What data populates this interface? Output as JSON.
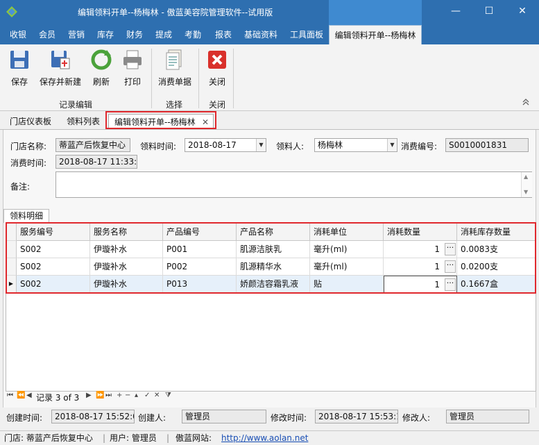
{
  "window": {
    "title": "编辑领料开单--杨梅林 - 傲蓝美容院管理软件--试用版",
    "min_glyph": "—",
    "max_glyph": "☐",
    "close_glyph": "✕"
  },
  "ribbon_tabs": [
    "收银",
    "会员",
    "营销",
    "库存",
    "财务",
    "提成",
    "考勤",
    "报表",
    "基础资料",
    "工具面板",
    "编辑领料开单--杨梅林"
  ],
  "ribbon": {
    "save": "保存",
    "save_new": "保存并新建",
    "refresh": "刷新",
    "print": "打印",
    "consume_doc": "消费单据",
    "close": "关闭",
    "group_record": "记录编辑",
    "group_select": "选择",
    "group_close": "关闭"
  },
  "doc_tabs": {
    "dashboard": "门店仪表板",
    "list": "领料列表",
    "edit": "编辑领料开单--杨梅林",
    "close_glyph": "✕"
  },
  "form": {
    "store_label": "门店名称:",
    "store_value": "蒂蓝产后恢复中心",
    "pick_time_label": "领料时间:",
    "pick_time_value": "2018-08-17",
    "picker_label": "领料人:",
    "picker_value": "杨梅林",
    "consume_no_label": "消费编号:",
    "consume_no_value": "S0010001831",
    "consume_time_label": "消费时间:",
    "consume_time_value": "2018-08-17 11:33:3",
    "remark_label": "备注:",
    "remark_value": ""
  },
  "detail_tab": "领料明细",
  "grid": {
    "columns": [
      "服务编号",
      "服务名称",
      "产品编号",
      "产品名称",
      "消耗单位",
      "消耗数量",
      "消耗库存数量"
    ],
    "rows": [
      [
        "S002",
        "伊璇补水",
        "P001",
        "肌源洁肤乳",
        "毫升(ml)",
        "1",
        "0.0083支"
      ],
      [
        "S002",
        "伊璇补水",
        "P002",
        "肌源精华水",
        "毫升(ml)",
        "1",
        "0.0200支"
      ],
      [
        "S002",
        "伊璇补水",
        "P013",
        "娇颜洁容霜乳液",
        "贴",
        "1",
        "0.1667盒"
      ]
    ],
    "selected_row": 2
  },
  "navigator": {
    "record_text": "记录 3 of 3"
  },
  "audit": {
    "created_time_label": "创建时间:",
    "created_time_value": "2018-08-17 15:52:0",
    "creator_label": "创建人:",
    "creator_value": "管理员",
    "modified_time_label": "修改时间:",
    "modified_time_value": "2018-08-17 15:53:1",
    "modifier_label": "修改人:",
    "modifier_value": "管理员"
  },
  "status": {
    "store": "门店: 蒂蓝产后恢复中心",
    "user": "用户: 管理员",
    "site_label": "傲蓝网站:",
    "site_url": "http://www.aolan.net"
  },
  "colors": {
    "titlebar": "#2e6fb0",
    "highlight": "#e0282d"
  }
}
